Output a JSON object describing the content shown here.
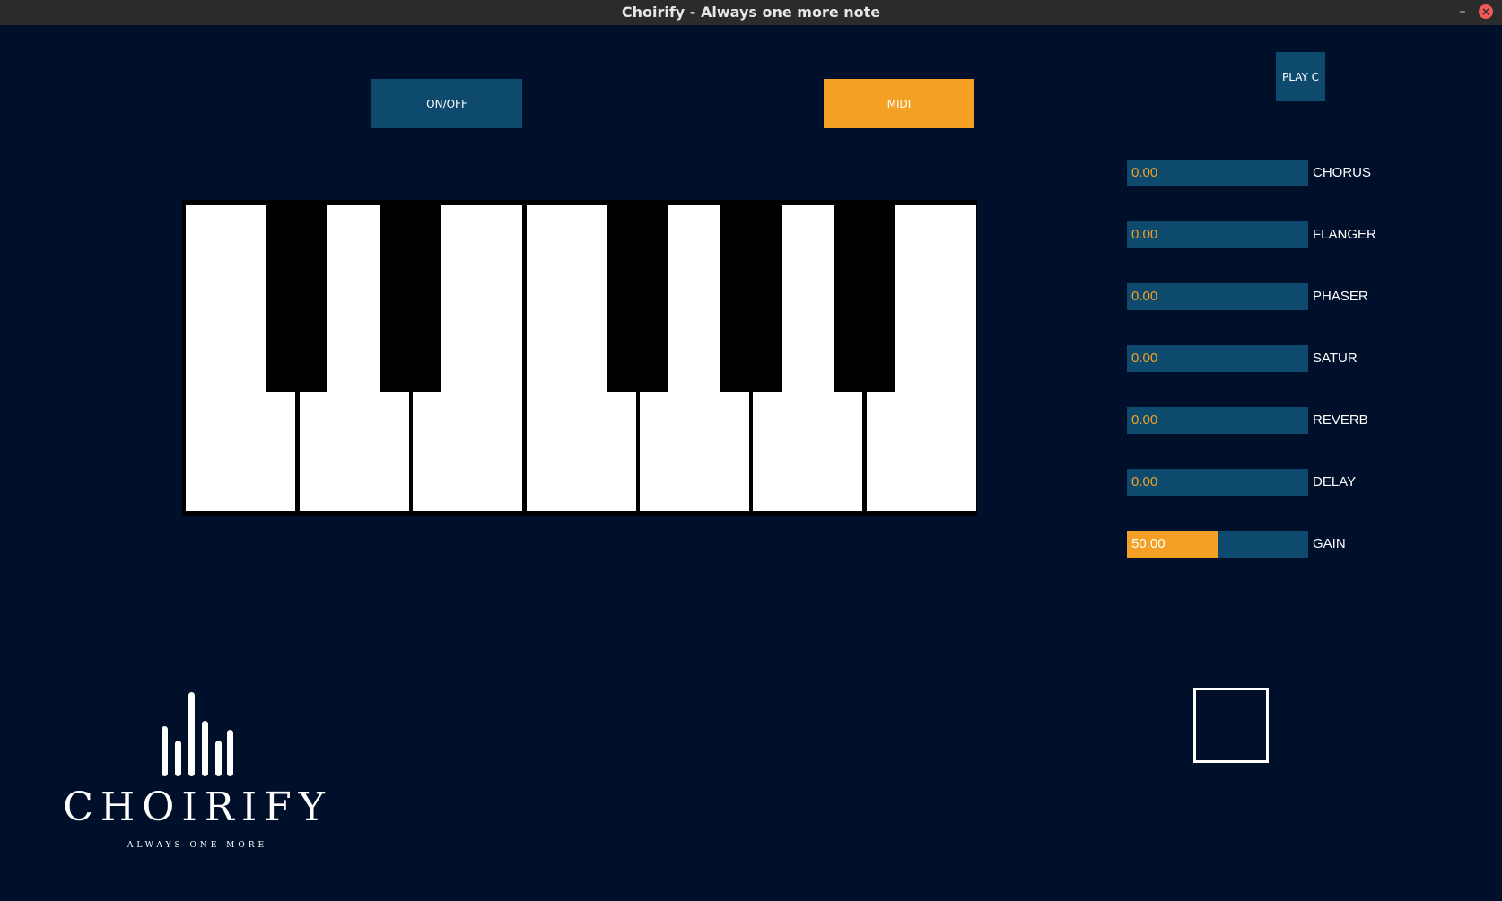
{
  "window": {
    "title": "Choirify - Always one more note",
    "minimize_glyph": "–",
    "close_glyph": "×"
  },
  "controls": {
    "onoff_label": "ON/OFF",
    "midi_label": "MIDI",
    "play_label": "PLAY C"
  },
  "colors": {
    "background": "#000f2a",
    "accent": "#f4a024",
    "button": "#0d4a6e"
  },
  "keyboard": {
    "white_keys": 7,
    "black_keys": 5
  },
  "effects": [
    {
      "label": "CHORUS",
      "value": "0.00",
      "level": 0.0
    },
    {
      "label": "FLANGER",
      "value": "0.00",
      "level": 0.0
    },
    {
      "label": "PHASER",
      "value": "0.00",
      "level": 0.0
    },
    {
      "label": "SATUR",
      "value": "0.00",
      "level": 0.0
    },
    {
      "label": "REVERB",
      "value": "0.00",
      "level": 0.0
    },
    {
      "label": "DELAY",
      "value": "0.00",
      "level": 0.0
    },
    {
      "label": "GAIN",
      "value": "50.00",
      "level": 0.5
    }
  ],
  "logo": {
    "wordmark": "CHOIRIFY",
    "tagline": "ALWAYS ONE MORE"
  }
}
